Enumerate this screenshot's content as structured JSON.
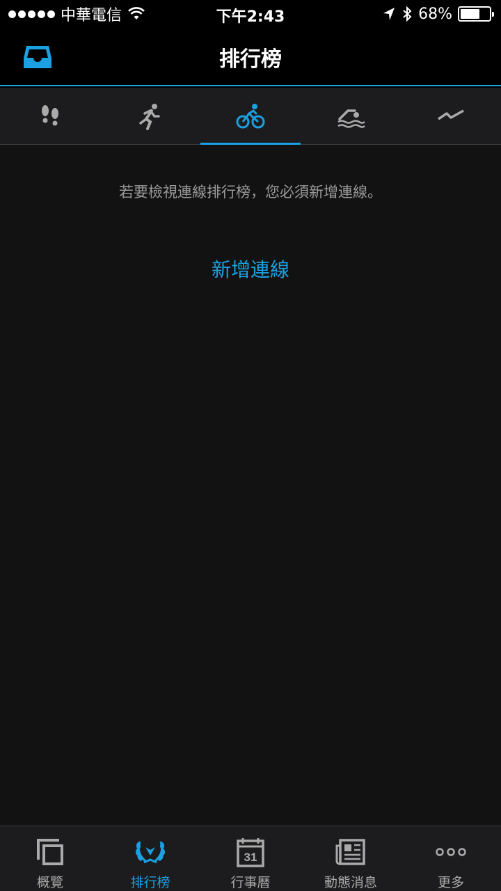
{
  "status_bar": {
    "carrier": "中華電信",
    "time": "下午2:43",
    "battery_percent": "68%",
    "battery_level": 0.68
  },
  "nav": {
    "title": "排行榜"
  },
  "activity_tabs": [
    {
      "icon": "footsteps-icon",
      "active": false
    },
    {
      "icon": "running-icon",
      "active": false
    },
    {
      "icon": "cycling-icon",
      "active": true
    },
    {
      "icon": "swimming-icon",
      "active": false
    },
    {
      "icon": "activity-icon",
      "active": false
    }
  ],
  "content": {
    "message": "若要檢視連線排行榜，您必須新增連線。",
    "add_connection_label": "新增連線"
  },
  "tab_bar": {
    "items": [
      {
        "label": "概覽",
        "icon": "overview-icon",
        "active": false
      },
      {
        "label": "排行榜",
        "icon": "laurel-icon",
        "active": true
      },
      {
        "label": "行事曆",
        "icon": "calendar-icon",
        "active": false,
        "icon_text": "31"
      },
      {
        "label": "動態消息",
        "icon": "newspaper-icon",
        "active": false
      },
      {
        "label": "更多",
        "icon": "more-icon",
        "active": false
      }
    ]
  },
  "colors": {
    "accent": "#1ba0e1",
    "background": "#121212",
    "bar": "#1c1c1e",
    "inactive_icon": "#aaaaaa"
  }
}
